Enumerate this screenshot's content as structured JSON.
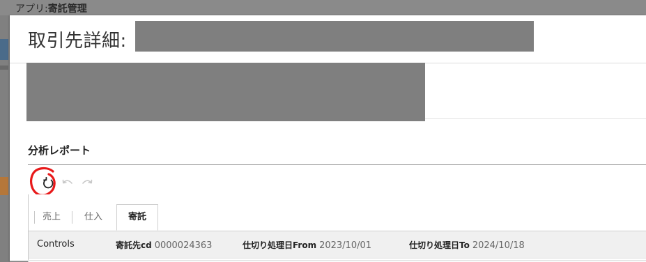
{
  "background_app": {
    "label_prefix": "アプリ:",
    "app_name": "寄託管理"
  },
  "modal": {
    "title": "取引先詳細:",
    "section_title": "分析レポート"
  },
  "toolbar": {
    "refresh_icon": "refresh-icon",
    "undo_icon": "undo-icon",
    "redo_icon": "redo-icon",
    "annotation_color": "#e8191a"
  },
  "tabs": [
    {
      "label": "売上",
      "active": false
    },
    {
      "label": "仕入",
      "active": false
    },
    {
      "label": "寄託",
      "active": true
    }
  ],
  "controls": {
    "title": "Controls",
    "fields": [
      {
        "key": "寄託先cd",
        "value": "0000024363"
      },
      {
        "key": "仕切り処理日From",
        "value": "2023/10/01"
      },
      {
        "key": "仕切り処理日To",
        "value": "2024/10/18"
      }
    ]
  }
}
